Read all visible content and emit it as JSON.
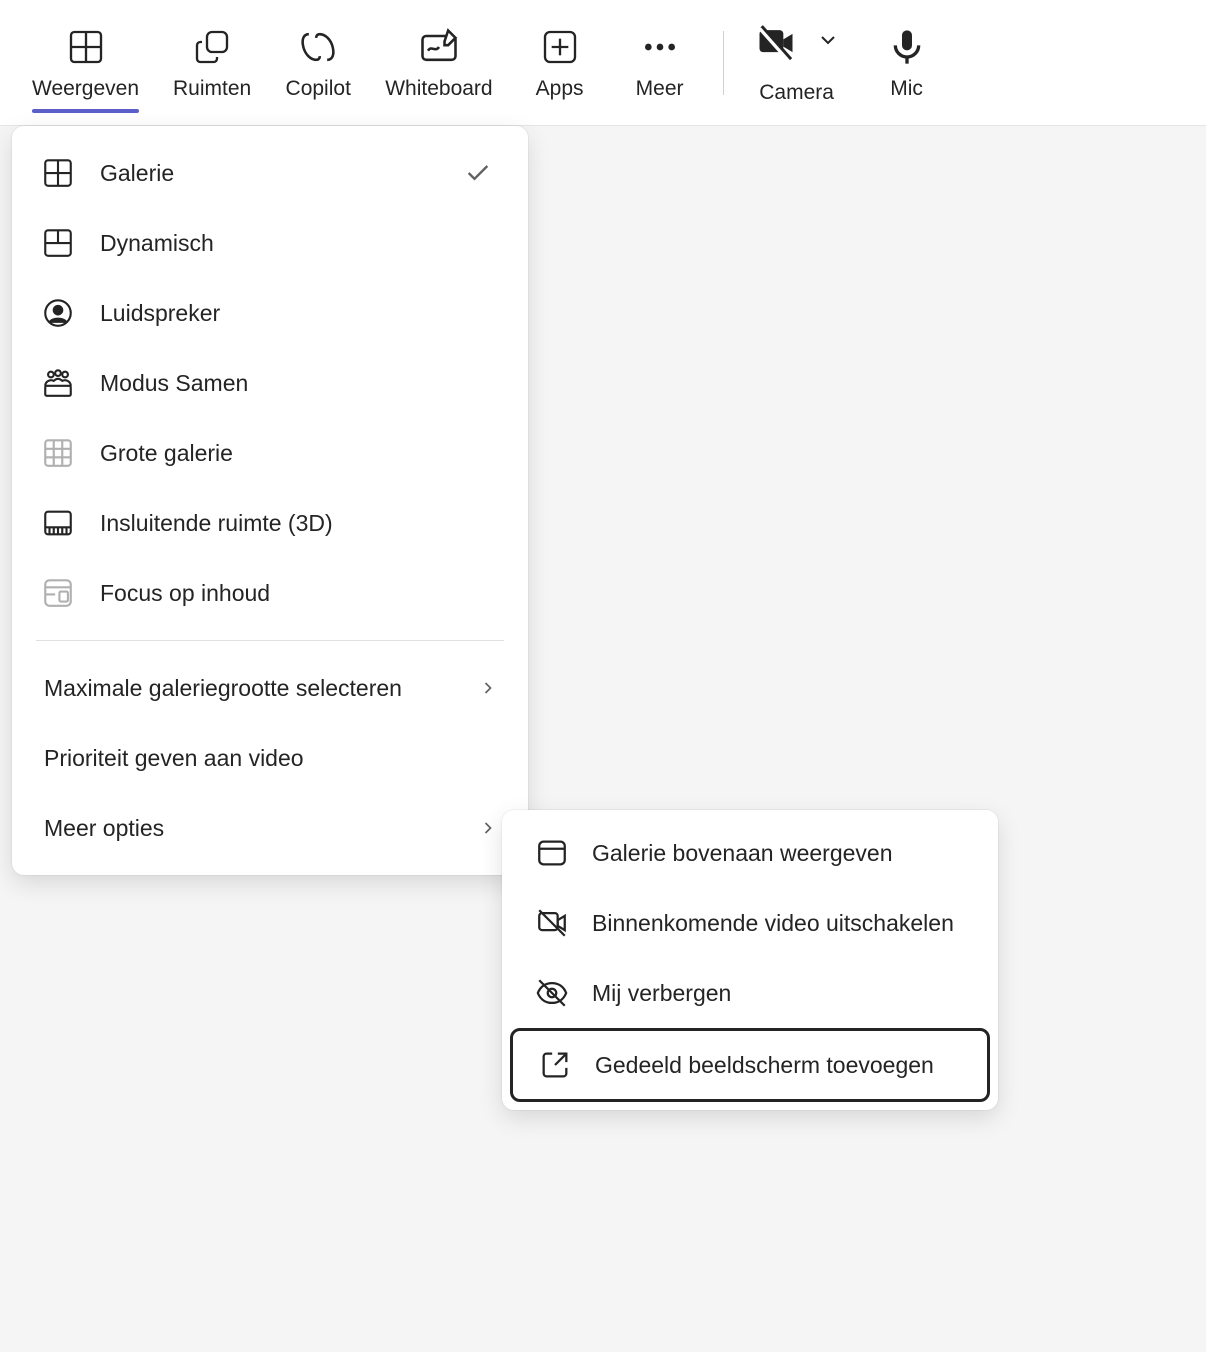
{
  "toolbar": {
    "items": [
      {
        "label": "Weergeven",
        "icon": "gallery-icon",
        "active": true
      },
      {
        "label": "Ruimten",
        "icon": "rooms-icon"
      },
      {
        "label": "Copilot",
        "icon": "copilot-icon"
      },
      {
        "label": "Whiteboard",
        "icon": "whiteboard-icon"
      },
      {
        "label": "Apps",
        "icon": "apps-icon"
      },
      {
        "label": "Meer",
        "icon": "more-icon"
      },
      {
        "label": "Camera",
        "icon": "camera-off-icon"
      },
      {
        "label": "Mic",
        "icon": "mic-icon"
      }
    ]
  },
  "menu": {
    "view_options": [
      {
        "label": "Galerie",
        "icon": "gallery-icon",
        "checked": true
      },
      {
        "label": "Dynamisch",
        "icon": "dynamic-gallery-icon"
      },
      {
        "label": "Luidspreker",
        "icon": "speaker-icon"
      },
      {
        "label": "Modus Samen",
        "icon": "together-mode-icon"
      },
      {
        "label": "Grote galerie",
        "icon": "large-gallery-icon",
        "disabled": true
      },
      {
        "label": "Insluitende ruimte (3D)",
        "icon": "immersive-icon"
      },
      {
        "label": "Focus op inhoud",
        "icon": "focus-content-icon",
        "disabled": true
      }
    ],
    "actions": [
      {
        "label": "Maximale galeriegrootte selecteren",
        "chevron": true
      },
      {
        "label": "Prioriteit geven aan video"
      },
      {
        "label": "Meer opties",
        "chevron": true
      }
    ]
  },
  "submenu": {
    "items": [
      {
        "label": "Galerie bovenaan weergeven",
        "icon": "window-icon"
      },
      {
        "label": "Binnenkomende video uitschakelen",
        "icon": "video-off-icon"
      },
      {
        "label": "Mij verbergen",
        "icon": "eye-off-icon"
      },
      {
        "label": "Gedeeld beeldscherm toevoegen",
        "icon": "popout-icon",
        "highlighted": true
      }
    ]
  }
}
